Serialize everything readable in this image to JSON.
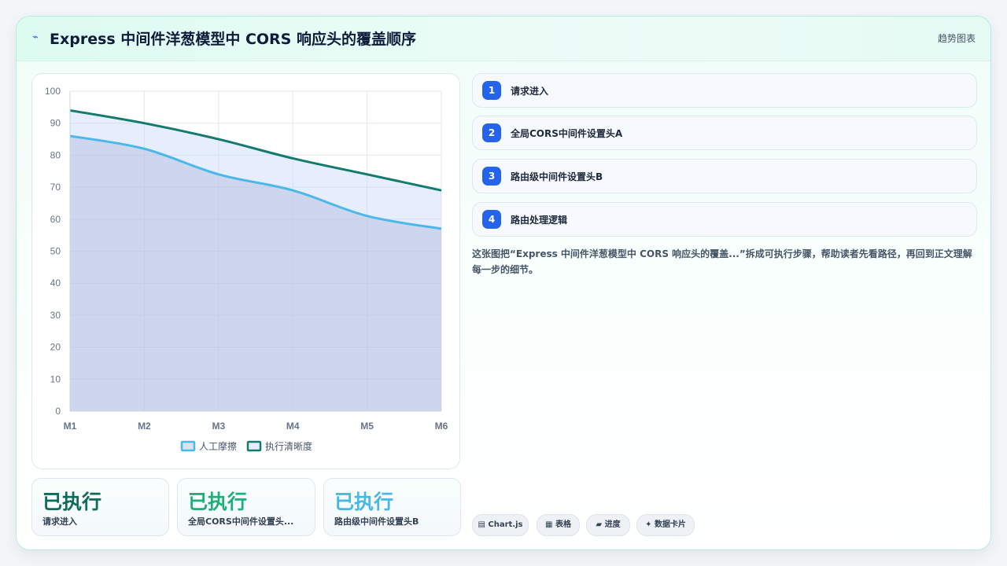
{
  "header": {
    "icon": "zigzag-icon",
    "title": "Express 中间件洋葱模型中 CORS 响应头的覆盖顺序",
    "tag": "趋势图表"
  },
  "chart_data": {
    "type": "area",
    "categories": [
      "M1",
      "M2",
      "M3",
      "M4",
      "M5",
      "M6"
    ],
    "series": [
      {
        "name": "人工摩擦",
        "values": [
          86,
          82,
          74,
          69,
          61,
          57
        ],
        "color": "#4cb8e9",
        "fill": "rgba(170,180,215,0.40)"
      },
      {
        "name": "执行清晰度",
        "values": [
          94,
          90,
          85,
          79,
          74,
          69
        ],
        "color": "#157a6e",
        "fill": "rgba(200,215,250,0.45)"
      }
    ],
    "ylim": [
      0,
      100
    ],
    "yticks": [
      0,
      10,
      20,
      30,
      40,
      50,
      60,
      70,
      80,
      90,
      100
    ],
    "grid": true,
    "legend": "bottom"
  },
  "stats": [
    {
      "value": "已执行",
      "label": "请求进入",
      "color": "#0f6b5c"
    },
    {
      "value": "已执行",
      "label": "全局CORS中间件设置头...",
      "color": "#1fb07a"
    },
    {
      "value": "已执行",
      "label": "路由级中间件设置头B",
      "color": "#48b9e6"
    }
  ],
  "steps": [
    {
      "num": "1",
      "label": "请求进入"
    },
    {
      "num": "2",
      "label": "全局CORS中间件设置头A"
    },
    {
      "num": "3",
      "label": "路由级中间件设置头B"
    },
    {
      "num": "4",
      "label": "路由处理逻辑"
    }
  ],
  "description": "这张图把“Express 中间件洋葱模型中 CORS 响应头的覆盖...”拆成可执行步骤，帮助读者先看路径，再回到正文理解每一步的细节。",
  "chips": [
    {
      "icon": "▤",
      "label": "Chart.js"
    },
    {
      "icon": "▦",
      "label": "表格"
    },
    {
      "icon": "▰",
      "label": "进度"
    },
    {
      "icon": "✦",
      "label": "数据卡片"
    }
  ]
}
